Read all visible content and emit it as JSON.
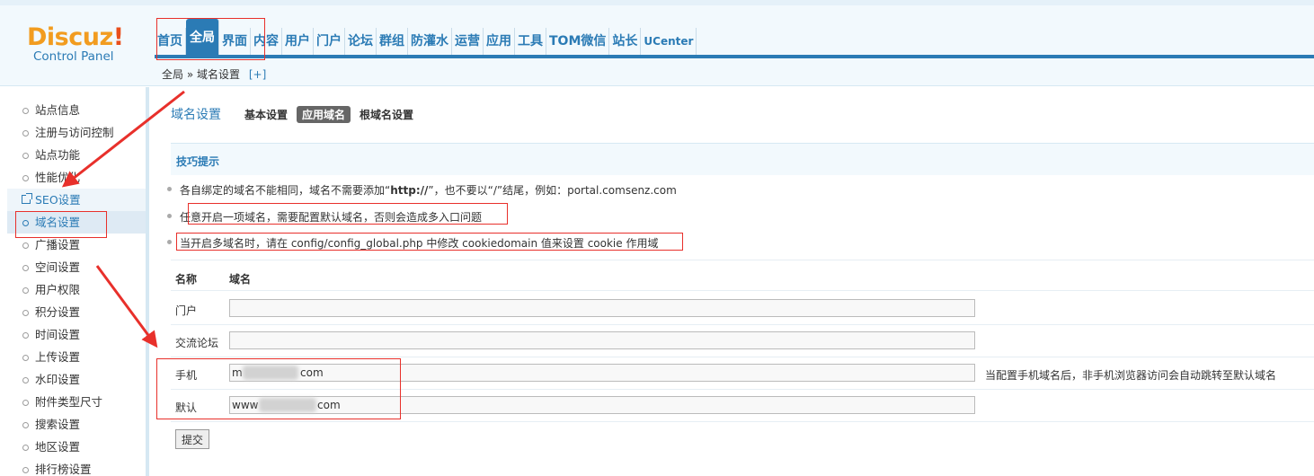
{
  "header": {
    "logo_word": "Discuz",
    "logo_bang": "!",
    "logo_sub": "Control Panel",
    "nav": [
      "首页",
      "全局",
      "界面",
      "内容",
      "用户",
      "门户",
      "论坛",
      "群组",
      "防灌水",
      "运营",
      "应用",
      "工具",
      "TOM微信",
      "站长",
      "UCenter"
    ],
    "active_nav_index": 1
  },
  "breadcrumb": {
    "root": "全局",
    "sep": "»",
    "current": "域名设置",
    "add": "[+]"
  },
  "sidebar": {
    "items": [
      "站点信息",
      "注册与访问控制",
      "站点功能",
      "性能优化",
      "SEO设置",
      "域名设置",
      "广播设置",
      "空间设置",
      "用户权限",
      "积分设置",
      "时间设置",
      "上传设置",
      "水印设置",
      "附件类型尺寸",
      "搜索设置",
      "地区设置",
      "排行榜设置"
    ],
    "current_index": 5
  },
  "main": {
    "title": "域名设置",
    "tabs": [
      "基本设置",
      "应用域名",
      "根域名设置"
    ],
    "active_tab_index": 1,
    "tips_title": "技巧提示",
    "tips": [
      {
        "pre": "各自绑定的域名不能相同，域名不需要添加“",
        "bold": "http://",
        "post": "”，也不要以“/”结尾，例如：portal.comsenz.com"
      },
      {
        "text": "任意开启一项域名，需要配置默认域名，否则会造成多入口问题"
      },
      {
        "text": "当开启多域名时，请在 config/config_global.php 中修改 cookiedomain 值来设置 cookie 作用域"
      }
    ],
    "table": {
      "col_name": "名称",
      "col_domain": "域名",
      "rows": [
        {
          "label": "门户",
          "value": "",
          "note": ""
        },
        {
          "label": "交流论坛",
          "value": "",
          "note": ""
        },
        {
          "label": "手机",
          "value": "m",
          "value_end": "com",
          "note": "当配置手机域名后，非手机浏览器访问会自动跳转至默认域名"
        },
        {
          "label": "默认",
          "value": "www",
          "value_end": "com",
          "note": ""
        }
      ]
    },
    "submit_label": "提交"
  },
  "colors": {
    "accent": "#2b7bb5",
    "annotation_red": "#e8302b",
    "logo_orange": "#f29c1f"
  }
}
